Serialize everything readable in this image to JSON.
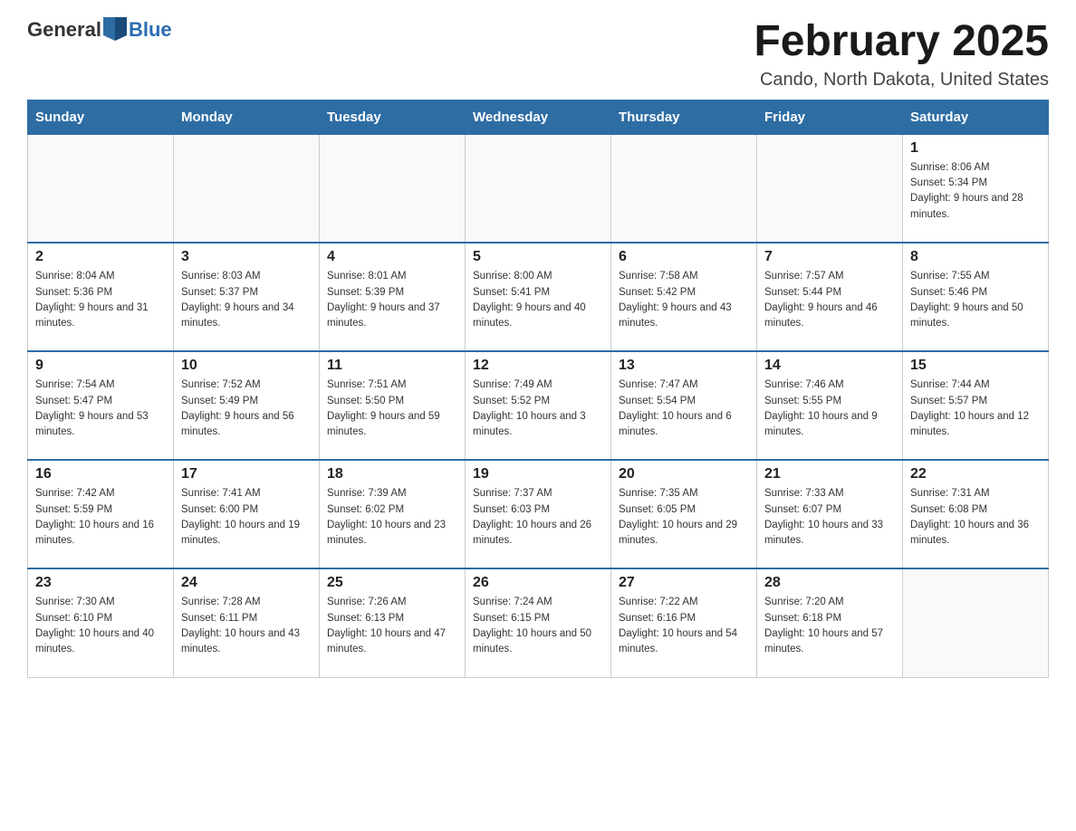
{
  "logo": {
    "general": "General",
    "blue": "Blue"
  },
  "header": {
    "title": "February 2025",
    "subtitle": "Cando, North Dakota, United States"
  },
  "days_of_week": [
    "Sunday",
    "Monday",
    "Tuesday",
    "Wednesday",
    "Thursday",
    "Friday",
    "Saturday"
  ],
  "weeks": [
    [
      {
        "day": "",
        "info": ""
      },
      {
        "day": "",
        "info": ""
      },
      {
        "day": "",
        "info": ""
      },
      {
        "day": "",
        "info": ""
      },
      {
        "day": "",
        "info": ""
      },
      {
        "day": "",
        "info": ""
      },
      {
        "day": "1",
        "info": "Sunrise: 8:06 AM\nSunset: 5:34 PM\nDaylight: 9 hours and 28 minutes."
      }
    ],
    [
      {
        "day": "2",
        "info": "Sunrise: 8:04 AM\nSunset: 5:36 PM\nDaylight: 9 hours and 31 minutes."
      },
      {
        "day": "3",
        "info": "Sunrise: 8:03 AM\nSunset: 5:37 PM\nDaylight: 9 hours and 34 minutes."
      },
      {
        "day": "4",
        "info": "Sunrise: 8:01 AM\nSunset: 5:39 PM\nDaylight: 9 hours and 37 minutes."
      },
      {
        "day": "5",
        "info": "Sunrise: 8:00 AM\nSunset: 5:41 PM\nDaylight: 9 hours and 40 minutes."
      },
      {
        "day": "6",
        "info": "Sunrise: 7:58 AM\nSunset: 5:42 PM\nDaylight: 9 hours and 43 minutes."
      },
      {
        "day": "7",
        "info": "Sunrise: 7:57 AM\nSunset: 5:44 PM\nDaylight: 9 hours and 46 minutes."
      },
      {
        "day": "8",
        "info": "Sunrise: 7:55 AM\nSunset: 5:46 PM\nDaylight: 9 hours and 50 minutes."
      }
    ],
    [
      {
        "day": "9",
        "info": "Sunrise: 7:54 AM\nSunset: 5:47 PM\nDaylight: 9 hours and 53 minutes."
      },
      {
        "day": "10",
        "info": "Sunrise: 7:52 AM\nSunset: 5:49 PM\nDaylight: 9 hours and 56 minutes."
      },
      {
        "day": "11",
        "info": "Sunrise: 7:51 AM\nSunset: 5:50 PM\nDaylight: 9 hours and 59 minutes."
      },
      {
        "day": "12",
        "info": "Sunrise: 7:49 AM\nSunset: 5:52 PM\nDaylight: 10 hours and 3 minutes."
      },
      {
        "day": "13",
        "info": "Sunrise: 7:47 AM\nSunset: 5:54 PM\nDaylight: 10 hours and 6 minutes."
      },
      {
        "day": "14",
        "info": "Sunrise: 7:46 AM\nSunset: 5:55 PM\nDaylight: 10 hours and 9 minutes."
      },
      {
        "day": "15",
        "info": "Sunrise: 7:44 AM\nSunset: 5:57 PM\nDaylight: 10 hours and 12 minutes."
      }
    ],
    [
      {
        "day": "16",
        "info": "Sunrise: 7:42 AM\nSunset: 5:59 PM\nDaylight: 10 hours and 16 minutes."
      },
      {
        "day": "17",
        "info": "Sunrise: 7:41 AM\nSunset: 6:00 PM\nDaylight: 10 hours and 19 minutes."
      },
      {
        "day": "18",
        "info": "Sunrise: 7:39 AM\nSunset: 6:02 PM\nDaylight: 10 hours and 23 minutes."
      },
      {
        "day": "19",
        "info": "Sunrise: 7:37 AM\nSunset: 6:03 PM\nDaylight: 10 hours and 26 minutes."
      },
      {
        "day": "20",
        "info": "Sunrise: 7:35 AM\nSunset: 6:05 PM\nDaylight: 10 hours and 29 minutes."
      },
      {
        "day": "21",
        "info": "Sunrise: 7:33 AM\nSunset: 6:07 PM\nDaylight: 10 hours and 33 minutes."
      },
      {
        "day": "22",
        "info": "Sunrise: 7:31 AM\nSunset: 6:08 PM\nDaylight: 10 hours and 36 minutes."
      }
    ],
    [
      {
        "day": "23",
        "info": "Sunrise: 7:30 AM\nSunset: 6:10 PM\nDaylight: 10 hours and 40 minutes."
      },
      {
        "day": "24",
        "info": "Sunrise: 7:28 AM\nSunset: 6:11 PM\nDaylight: 10 hours and 43 minutes."
      },
      {
        "day": "25",
        "info": "Sunrise: 7:26 AM\nSunset: 6:13 PM\nDaylight: 10 hours and 47 minutes."
      },
      {
        "day": "26",
        "info": "Sunrise: 7:24 AM\nSunset: 6:15 PM\nDaylight: 10 hours and 50 minutes."
      },
      {
        "day": "27",
        "info": "Sunrise: 7:22 AM\nSunset: 6:16 PM\nDaylight: 10 hours and 54 minutes."
      },
      {
        "day": "28",
        "info": "Sunrise: 7:20 AM\nSunset: 6:18 PM\nDaylight: 10 hours and 57 minutes."
      },
      {
        "day": "",
        "info": ""
      }
    ]
  ]
}
